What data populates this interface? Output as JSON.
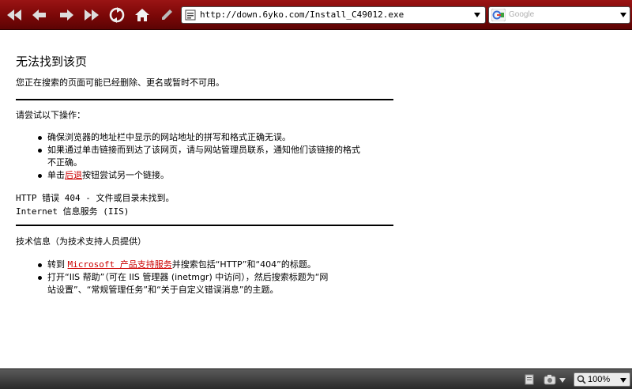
{
  "browser": {
    "url": "http://down.6yko.com/Install_C49012.exe",
    "search_placeholder": "Google",
    "zoom": "100%",
    "icons": [
      "rewind-icon",
      "back-icon",
      "forward-icon",
      "fast-forward-icon",
      "refresh-icon",
      "home-icon",
      "edit-icon"
    ],
    "colors": {
      "toolbar": "#7a0707",
      "link": "#cc0000"
    }
  },
  "page": {
    "title": "无法找到该页",
    "subtitle": "您正在搜索的页面可能已经删除、更名或暂时不可用。",
    "try_heading": "请尝试以下操作：",
    "bullets": {
      "b1": "确保浏览器的地址栏中显示的网站地址的拼写和格式正确无误。",
      "b2_line1": "如果通过单击链接而到达了该网页，请与网站管理员联系，通知他们该链接的格式",
      "b2_line2": "不正确。",
      "b3_prefix": "单击",
      "b3_link": "后退",
      "b3_suffix": "按钮尝试另一个链接。"
    },
    "error_line1": "HTTP 错误 404 - 文件或目录未找到。",
    "error_line2": "Internet 信息服务 (IIS)",
    "tech_heading": "技术信息（为技术支持人员提供）",
    "tech": {
      "t1_prefix": "转到 ",
      "t1_link": "Microsoft 产品支持服务",
      "t1_suffix": "并搜索包括“HTTP”和“404”的标题。",
      "t2_line1": "打开“IIS 帮助”（可在 IIS 管理器 (inetmgr) 中访问），然后搜索标题为“网",
      "t2_line2": "站设置”、“常规管理任务”和“关于自定义错误消息”的主题。"
    }
  }
}
